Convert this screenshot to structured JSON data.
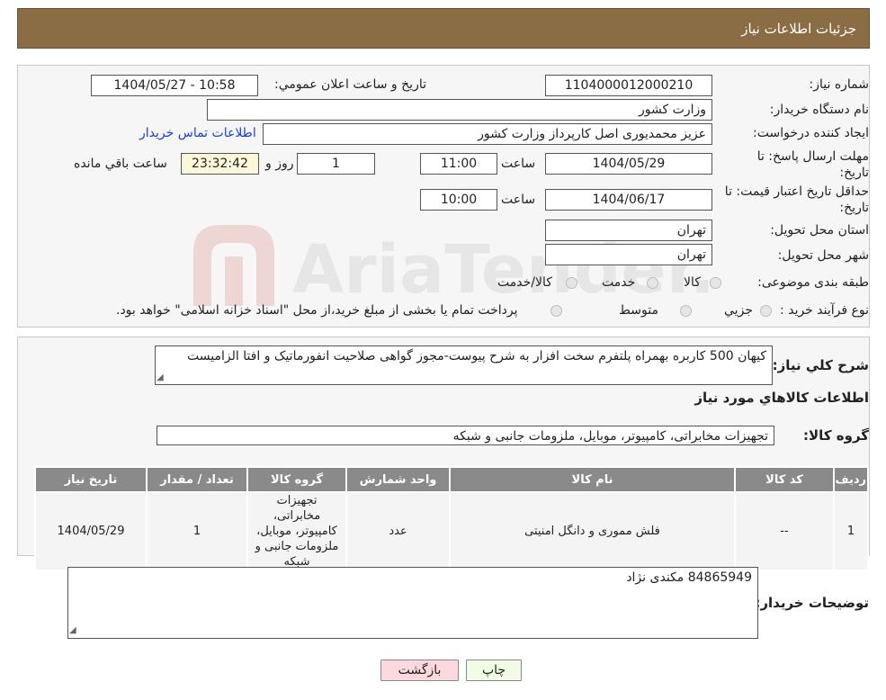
{
  "header": {
    "title": "جزئيات اطلاعات نیاز"
  },
  "fields": {
    "need_number_label": "شماره نياز:",
    "need_number": "1104000012000210",
    "announce_label": "تاريخ و ساعت اعلان عمومي:",
    "announce_value": "1404/05/27 - 10:58",
    "buyer_org_label": "نام دستگاه خريدار:",
    "buyer_org": "وزارت کشور",
    "creator_label": "ايجاد کننده درخواست:",
    "creator": "عزيز محمديوری اصل کارپرداز وزارت کشور",
    "contact_link": "اطلاعات تماس خريدار",
    "deadline_label_1": "مهلت ارسال پاسخ: تا",
    "deadline_label_2": "تاريخ:",
    "deadline_date": "1404/05/29",
    "time_label": "ساعت",
    "deadline_time": "11:00",
    "days_value": "1",
    "days_label": "روز و",
    "remaining_time": "23:32:42",
    "remaining_label": "ساعت باقي مانده",
    "validity_label_1": "حداقل تاريخ اعتبار قيمت: تا",
    "validity_label_2": "تاريخ:",
    "validity_date": "1404/06/17",
    "validity_time_label": "ساعت",
    "validity_time": "10:00",
    "province_label": "استان محل تحويل:",
    "province": "تهران",
    "city_label": "شهر محل تحويل:",
    "city": "تهران",
    "category_label": "طبقه بندی موضوعی:",
    "category_options": [
      "کالا",
      "خدمت",
      "کالا/خدمت"
    ],
    "process_label": "نوع فرآيند خريد :",
    "process_options": [
      "جزيي",
      "متوسط"
    ],
    "process_note": "پرداخت تمام يا بخشی از مبلغ خريد،از محل \"اسناد خزانه اسلامی\" خواهد بود."
  },
  "description": {
    "label": "شرح کلي نياز:",
    "text": "کیهان 500 کاربره بهمراه پلتفرم سخت افزار به شرح پیوست-مجوز گواهی صلاحیت انفورماتیک و  افتا الزامیست",
    "goods_title": "اطلاعات کالاهاي مورد نياز",
    "group_label": "گروه کالا:",
    "group_value": "تجهيزات مخابراتی، کامپيوتر، موبايل، ملزومات جانبی و شبکه"
  },
  "table": {
    "headers": [
      "رديف",
      "کد کالا",
      "نام کالا",
      "واحد شمارش",
      "گروه کالا",
      "تعداد / مقدار",
      "تاريخ نياز"
    ],
    "rows": [
      {
        "row": "1",
        "code": "--",
        "name": "فلش مموری و دانگل امنيتی",
        "unit": "عدد",
        "group": "تجهيزات مخابراتی، کامپيوتر، موبايل، ملزومات جانبی و شبکه",
        "qty": "1",
        "date": "1404/05/29"
      }
    ]
  },
  "buyer_notes": {
    "label": "توضيحات خريدار:",
    "text": "84865949 مکندی نژاد"
  },
  "buttons": {
    "print": "چاپ",
    "back": "بازگشت"
  },
  "watermark": {
    "text": "AriaTender.neT"
  },
  "colors": {
    "header_bg": "#8b6d45",
    "table_header_bg": "#8a8a8a",
    "back_button_bg": "#fbd9de",
    "print_button_bg": "#f2fbe6",
    "link": "#1a3fd1"
  }
}
